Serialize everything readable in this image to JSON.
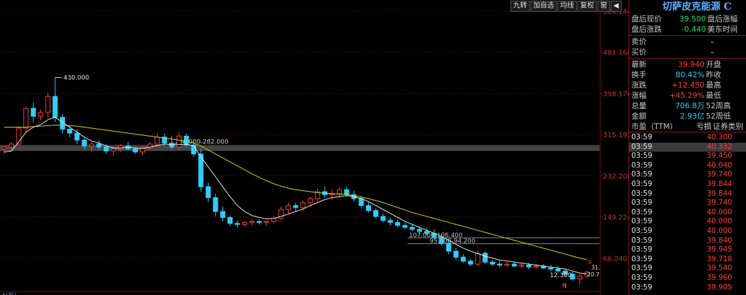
{
  "toolbar": {
    "buttons": [
      "九转",
      "加自选",
      "均线",
      "复权",
      "窗",
      "◀"
    ]
  },
  "price_axis": {
    "ticks": [
      "564.144",
      "481.160",
      "398.176",
      "315.192",
      "232.208",
      "149.224",
      "66.240"
    ]
  },
  "annotations": {
    "high_label": "430.000",
    "band_label": "294.000-282.000",
    "band2_label": "107.000-106.400",
    "band3_label": "95.000-94.200",
    "low_label": "12.300",
    "right_label_1": "31.",
    "right_label_2": "20.7",
    "marker_q": "q",
    "marker_9": "9",
    "bottom_left": "4(万)"
  },
  "colors": {
    "up": "#ff3b3b",
    "down": "#29d0ff",
    "ma_short": "#e6e6e6",
    "ma_long": "#d7d700",
    "grid": "#7a1010"
  },
  "chart_data": {
    "type": "candlestick",
    "title": "",
    "ylim": [
      0,
      564.144
    ],
    "candles": [
      [
        286,
        292,
        276,
        290
      ],
      [
        290,
        300,
        284,
        296
      ],
      [
        296,
        330,
        294,
        328
      ],
      [
        328,
        372,
        320,
        368
      ],
      [
        368,
        380,
        340,
        352
      ],
      [
        352,
        366,
        344,
        360
      ],
      [
        360,
        400,
        350,
        392
      ],
      [
        392,
        430,
        340,
        350
      ],
      [
        350,
        356,
        318,
        326
      ],
      [
        326,
        334,
        310,
        318
      ],
      [
        318,
        326,
        296,
        304
      ],
      [
        304,
        308,
        286,
        292
      ],
      [
        292,
        300,
        280,
        296
      ],
      [
        296,
        304,
        284,
        290
      ],
      [
        290,
        296,
        276,
        282
      ],
      [
        282,
        290,
        272,
        286
      ],
      [
        286,
        296,
        280,
        292
      ],
      [
        292,
        300,
        284,
        286
      ],
      [
        286,
        290,
        276,
        280
      ],
      [
        280,
        292,
        274,
        288
      ],
      [
        288,
        300,
        282,
        296
      ],
      [
        296,
        318,
        290,
        310
      ],
      [
        310,
        318,
        292,
        298
      ],
      [
        298,
        312,
        286,
        290
      ],
      [
        290,
        320,
        284,
        312
      ],
      [
        312,
        318,
        290,
        294
      ],
      [
        294,
        304,
        270,
        276
      ],
      [
        276,
        286,
        200,
        210
      ],
      [
        210,
        218,
        180,
        188
      ],
      [
        188,
        196,
        150,
        160
      ],
      [
        160,
        170,
        140,
        148
      ],
      [
        148,
        152,
        130,
        136
      ],
      [
        136,
        142,
        128,
        134
      ],
      [
        134,
        140,
        130,
        138
      ],
      [
        138,
        144,
        132,
        140
      ],
      [
        140,
        144,
        134,
        138
      ],
      [
        138,
        142,
        132,
        140
      ],
      [
        140,
        150,
        136,
        146
      ],
      [
        146,
        170,
        142,
        164
      ],
      [
        164,
        178,
        156,
        172
      ],
      [
        172,
        178,
        160,
        168
      ],
      [
        168,
        182,
        162,
        178
      ],
      [
        178,
        190,
        170,
        186
      ],
      [
        186,
        206,
        180,
        200
      ],
      [
        200,
        210,
        188,
        194
      ],
      [
        194,
        204,
        184,
        196
      ],
      [
        196,
        208,
        188,
        204
      ],
      [
        204,
        210,
        190,
        194
      ],
      [
        194,
        202,
        180,
        186
      ],
      [
        186,
        192,
        166,
        172
      ],
      [
        172,
        178,
        158,
        162
      ],
      [
        162,
        166,
        146,
        150
      ],
      [
        150,
        156,
        138,
        142
      ],
      [
        142,
        148,
        132,
        138
      ],
      [
        138,
        144,
        128,
        132
      ],
      [
        132,
        138,
        124,
        128
      ],
      [
        128,
        134,
        120,
        124
      ],
      [
        124,
        130,
        116,
        120
      ],
      [
        120,
        128,
        112,
        116
      ],
      [
        116,
        124,
        104,
        108
      ],
      [
        108,
        114,
        90,
        96
      ],
      [
        96,
        104,
        74,
        80
      ],
      [
        80,
        86,
        62,
        68
      ],
      [
        68,
        74,
        56,
        60
      ],
      [
        60,
        64,
        50,
        54
      ],
      [
        54,
        82,
        50,
        76
      ],
      [
        76,
        80,
        54,
        58
      ],
      [
        58,
        62,
        50,
        54
      ],
      [
        54,
        60,
        48,
        52
      ],
      [
        52,
        58,
        48,
        54
      ],
      [
        54,
        58,
        48,
        50
      ],
      [
        50,
        56,
        46,
        52
      ],
      [
        52,
        56,
        44,
        48
      ],
      [
        48,
        54,
        44,
        50
      ],
      [
        50,
        54,
        44,
        46
      ],
      [
        46,
        52,
        40,
        44
      ],
      [
        44,
        50,
        36,
        40
      ],
      [
        40,
        44,
        30,
        34
      ],
      [
        34,
        40,
        20,
        24
      ],
      [
        24,
        34,
        12,
        30
      ],
      [
        30,
        40,
        26,
        38
      ]
    ],
    "ma_short": [
      280,
      282,
      300,
      320,
      330,
      335,
      345,
      350,
      340,
      330,
      320,
      310,
      302,
      298,
      292,
      288,
      288,
      290,
      288,
      287,
      290,
      293,
      296,
      295,
      295,
      296,
      292,
      270,
      250,
      230,
      210,
      190,
      172,
      160,
      152,
      148,
      145,
      146,
      150,
      155,
      160,
      165,
      172,
      178,
      184,
      188,
      190,
      192,
      190,
      186,
      180,
      172,
      164,
      156,
      148,
      140,
      134,
      128,
      122,
      116,
      110,
      102,
      94,
      86,
      80,
      75,
      70,
      66,
      62,
      60,
      58,
      56,
      54,
      52,
      50,
      48,
      46,
      44,
      40,
      36,
      34
    ],
    "ma_long": [
      330,
      330,
      330,
      330,
      331,
      332,
      333,
      334,
      334,
      333,
      332,
      330,
      328,
      326,
      324,
      322,
      320,
      318,
      316,
      314,
      312,
      310,
      308,
      306,
      304,
      302,
      298,
      292,
      284,
      276,
      268,
      260,
      252,
      244,
      236,
      229,
      222,
      216,
      211,
      207,
      204,
      202,
      200,
      198,
      197,
      196,
      195,
      194,
      192,
      189,
      186,
      182,
      178,
      173,
      168,
      163,
      158,
      154,
      150,
      146,
      142,
      138,
      134,
      130,
      126,
      122,
      118,
      114,
      110,
      106,
      102,
      98,
      94,
      90,
      86,
      82,
      78,
      74,
      70,
      66,
      63
    ]
  },
  "right_panel": {
    "stock_title": "切萨皮克能源 C",
    "after_hours_price_label": "盘后现价",
    "after_hours_price": "39.500",
    "after_hours_pct_label": "盘后涨幅",
    "after_hours_change_label": "盘后涨跌",
    "after_hours_change": "-0.440",
    "us_time_label": "美东时间",
    "sell_label": "卖价",
    "sell_value": "–",
    "buy_label": "买价",
    "buy_value": "–",
    "stats": [
      {
        "label": "最新",
        "value": "39.940",
        "label2": "开盘",
        "color": "red"
      },
      {
        "label": "换手",
        "value": "80.42%",
        "label2": "昨收",
        "color": "cyan"
      },
      {
        "label": "涨跌",
        "value": "+12.450",
        "label2": "最高",
        "color": "red"
      },
      {
        "label": "涨幅",
        "value": "+45.29%",
        "label2": "最低",
        "color": "red"
      },
      {
        "label": "总量",
        "value": "706.8万",
        "label2": "52周高",
        "color": "cyan"
      },
      {
        "label": "金额",
        "value": "2.93亿",
        "label2": "52周低",
        "color": "cyan"
      },
      {
        "label": "市盈（TTM）",
        "value": "亏损",
        "label2": "证券类别",
        "color": "white"
      }
    ],
    "ticks": [
      {
        "time": "03:59",
        "price": "40.300"
      },
      {
        "time": "03:59",
        "price": "40.332"
      },
      {
        "time": "03:59",
        "price": "39.450"
      },
      {
        "time": "03:59",
        "price": "40.040"
      },
      {
        "time": "03:59",
        "price": "39.740"
      },
      {
        "time": "03:59",
        "price": "39.844"
      },
      {
        "time": "03:59",
        "price": "39.844"
      },
      {
        "time": "03:59",
        "price": "39.740"
      },
      {
        "time": "03:59",
        "price": "40.000"
      },
      {
        "time": "03:59",
        "price": "40.000"
      },
      {
        "time": "03:59",
        "price": "40.000"
      },
      {
        "time": "03:59",
        "price": "39.840"
      },
      {
        "time": "03:59",
        "price": "39.945"
      },
      {
        "time": "03:59",
        "price": "39.718"
      },
      {
        "time": "03:59",
        "price": "39.540"
      },
      {
        "time": "03:59",
        "price": "39.960"
      },
      {
        "time": "03:59",
        "price": "39.905"
      }
    ]
  }
}
